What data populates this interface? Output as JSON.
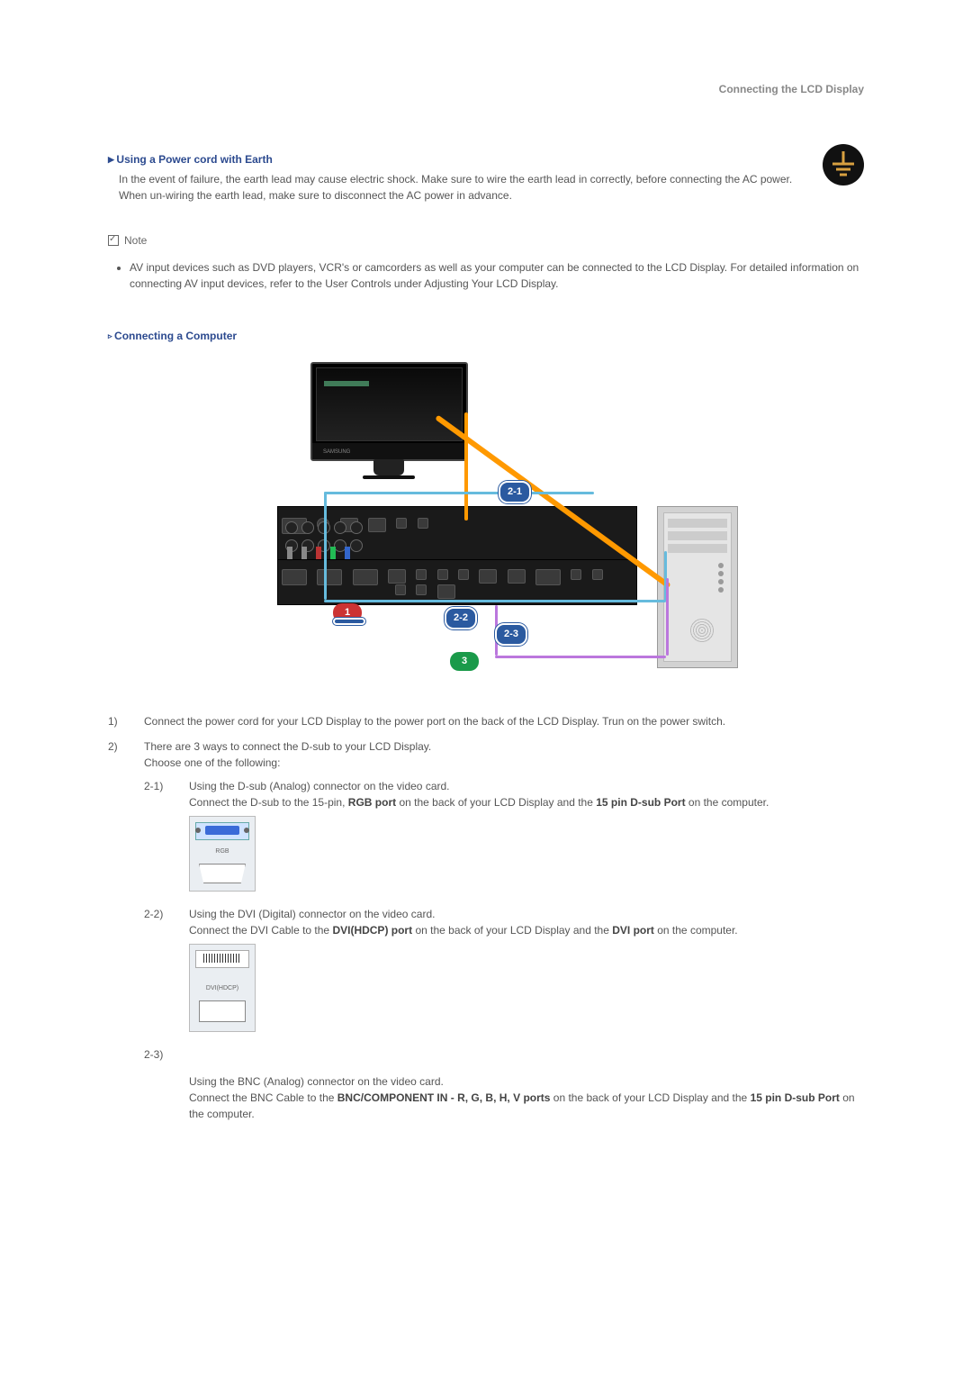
{
  "header": {
    "title": "Connecting the LCD Display"
  },
  "sections": {
    "power_heading": "Using a Power cord with Earth",
    "power_body": "In the event of failure, the earth lead may cause electric shock. Make sure to wire the earth lead in correctly, before connecting the AC power. When un-wiring the earth lead, make sure to disconnect the AC power in advance.",
    "earth_icon_label": "earth-symbol",
    "note_label": "Note",
    "note_bullet": "AV input devices such as DVD players, VCR's or camcorders as well as your computer can be connected to the LCD Display. For detailed information on connecting AV input devices, refer to the User Controls under Adjusting Your LCD Display.",
    "computer_heading": "Connecting a Computer"
  },
  "diagram": {
    "monitor_brand": "SAMSUNG",
    "callouts": {
      "c1": "2-1",
      "c2": "2-2",
      "c3": "2-3",
      "c_red1": "1",
      "c_green3": "3"
    }
  },
  "steps": {
    "s1_num": "1)",
    "s1_text": "Connect the power cord for your LCD Display to the power port on the back of the LCD Display. Trun on the power switch.",
    "s2_num": "2)",
    "s2_text_a": "There are 3 ways to connect the D-sub to your LCD Display. ",
    "s2_text_b": "Choose one of the following:",
    "sub": {
      "s21_num": "2-1)",
      "s21_line1": "Using the D-sub (Analog) connector on the video card.",
      "s21_line2_a": "Connect the D-sub to the 15-pin, ",
      "s21_line2_b": "RGB port",
      "s21_line2_c": " on the back of your LCD Display and the ",
      "s21_line2_d": "15 pin D-sub Port",
      "s21_line2_e": " on the computer.",
      "s21_thumb_label": "RGB",
      "s22_num": "2-2)",
      "s22_line1": "Using the DVI (Digital) connector on the video card.",
      "s22_line2_a": "Connect the DVI Cable to the ",
      "s22_line2_b": "DVI(HDCP) port",
      "s22_line2_c": " on the back of your LCD Display and the ",
      "s22_line2_d": "DVI port",
      "s22_line2_e": " on the computer.",
      "s22_thumb_label": "DVI(HDCP)",
      "s23_num": "2-3)",
      "s23_line1": "Using the BNC (Analog) connector on the video card.",
      "s23_line2_a": "Connect the BNC Cable to the ",
      "s23_line2_b": "BNC/COMPONENT IN - R, G, B, H, V ports",
      "s23_line2_c": " on the back of your LCD Display and the ",
      "s23_line2_d": "15 pin D-sub Port",
      "s23_line2_e": " on the computer."
    }
  }
}
